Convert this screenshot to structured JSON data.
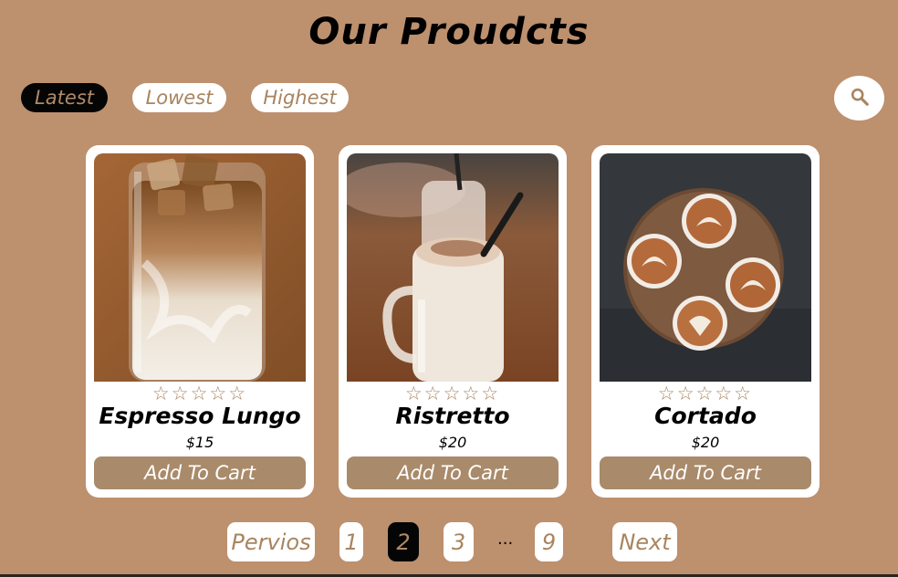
{
  "header": {
    "title": "Our Proudcts"
  },
  "sort": {
    "options": [
      {
        "label": "Latest",
        "active": true
      },
      {
        "label": "Lowest",
        "active": false
      },
      {
        "label": "Highest",
        "active": false
      }
    ]
  },
  "search": {
    "icon": "search-icon"
  },
  "products": [
    {
      "name": "Espresso Lungo",
      "price": "$15",
      "stars": "☆☆☆☆☆",
      "rating": 0,
      "button": "Add To Cart",
      "image": "iced-coffee-glass"
    },
    {
      "name": "Ristretto",
      "price": "$20",
      "stars": "☆☆☆☆☆",
      "rating": 0,
      "button": "Add To Cart",
      "image": "milkshake-mason-jars"
    },
    {
      "name": "Cortado",
      "price": "$20",
      "stars": "☆☆☆☆☆",
      "rating": 0,
      "button": "Add To Cart",
      "image": "latte-art-cups-top-view"
    }
  ],
  "pagination": {
    "prev": "Pervios",
    "pages": [
      "1",
      "2",
      "3"
    ],
    "ellipsis": "...",
    "last": "9",
    "current": "2",
    "next": "Next"
  },
  "colors": {
    "background": "#bd906e",
    "accent": "#a98a6a",
    "active": "#050505",
    "card": "#ffffff"
  }
}
